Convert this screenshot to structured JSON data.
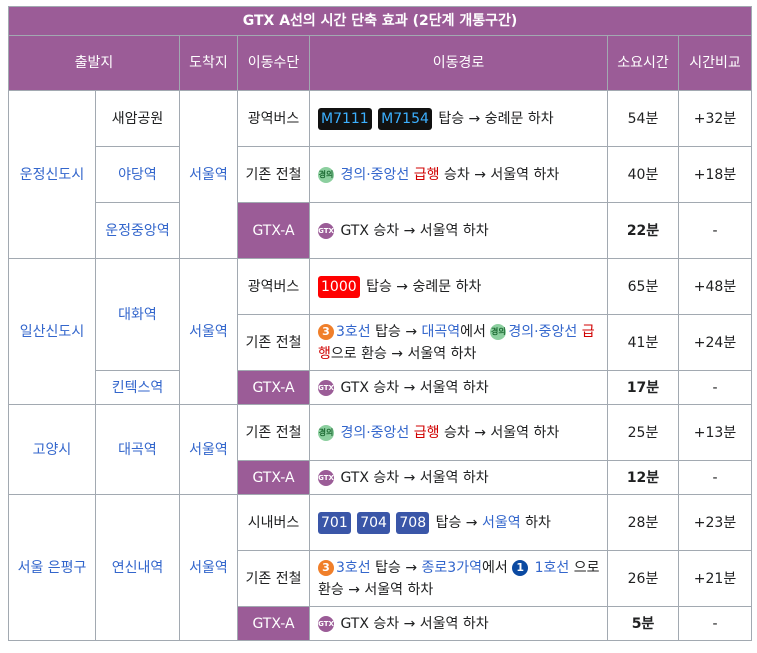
{
  "title": "GTX A선의 시간 단축 효과 (2단계 개통구간)",
  "headers": [
    "출발지",
    "도착지",
    "이동수단",
    "이동경로",
    "소요시간",
    "시간비교"
  ],
  "icons": {
    "gtx": "GTX",
    "gyeongui": "경의",
    "line1": "1",
    "line3": "3"
  },
  "groups": [
    {
      "region": "운정신도시",
      "dest": "서울역",
      "rows": [
        {
          "station": "새암공원",
          "mode": "광역버스",
          "badges": [
            "M7111",
            "M7154"
          ],
          "route": "탑승 → 숭례문 하차",
          "time": "54분",
          "diff": "+32분"
        },
        {
          "station": "야당역",
          "mode": "기존 전철",
          "line": "경의·중앙선",
          "express": "급행",
          "route": "승차 → 서울역 하차",
          "time": "40분",
          "diff": "+18분"
        },
        {
          "station": "운정중앙역",
          "mode": "GTX-A",
          "route": "GTX 승차 → 서울역 하차",
          "time": "22분",
          "diff": "-"
        }
      ]
    },
    {
      "region": "일산신도시",
      "dest": "서울역",
      "rows": [
        {
          "station": "대화역",
          "mode": "광역버스",
          "badges": [
            "1000"
          ],
          "route": "탑승 → 숭례문 하차",
          "time": "65분",
          "diff": "+48분"
        },
        {
          "mode": "기존 전철",
          "line": "3호선",
          "mid1": "탑승 →",
          "transfer": "대곡역",
          "mid2": "에서",
          "line2": "경의·중앙선",
          "express": "급행",
          "route": "으로 환승 → 서울역 하차",
          "time": "41분",
          "diff": "+24분"
        },
        {
          "station": "킨텍스역",
          "mode": "GTX-A",
          "route": "GTX 승차 → 서울역 하차",
          "time": "17분",
          "diff": "-"
        }
      ]
    },
    {
      "region": "고양시",
      "station": "대곡역",
      "dest": "서울역",
      "rows": [
        {
          "mode": "기존 전철",
          "line": "경의·중앙선",
          "express": "급행",
          "route": "승차 → 서울역 하차",
          "time": "25분",
          "diff": "+13분"
        },
        {
          "mode": "GTX-A",
          "route": "GTX 승차 → 서울역 하차",
          "time": "12분",
          "diff": "-"
        }
      ]
    },
    {
      "region": "서울 은평구",
      "station": "연신내역",
      "dest": "서울역",
      "rows": [
        {
          "mode": "시내버스",
          "badges": [
            "701",
            "704",
            "708"
          ],
          "route": "탑승 →",
          "route_link": "서울역",
          "route_end": "하차",
          "time": "28분",
          "diff": "+23분"
        },
        {
          "mode": "기존 전철",
          "line": "3호선",
          "mid1": "탑승 →",
          "transfer": "종로3가역",
          "mid2": "에서",
          "line2": "1호선",
          "route": "으로 환승 → 서울역 하차",
          "time": "26분",
          "diff": "+21분"
        },
        {
          "mode": "GTX-A",
          "route": "GTX 승차 → 서울역 하차",
          "time": "5분",
          "diff": "-"
        }
      ]
    }
  ],
  "colors": {
    "header": "#9b5c97",
    "link": "#3366cc",
    "express": "#d00000"
  }
}
